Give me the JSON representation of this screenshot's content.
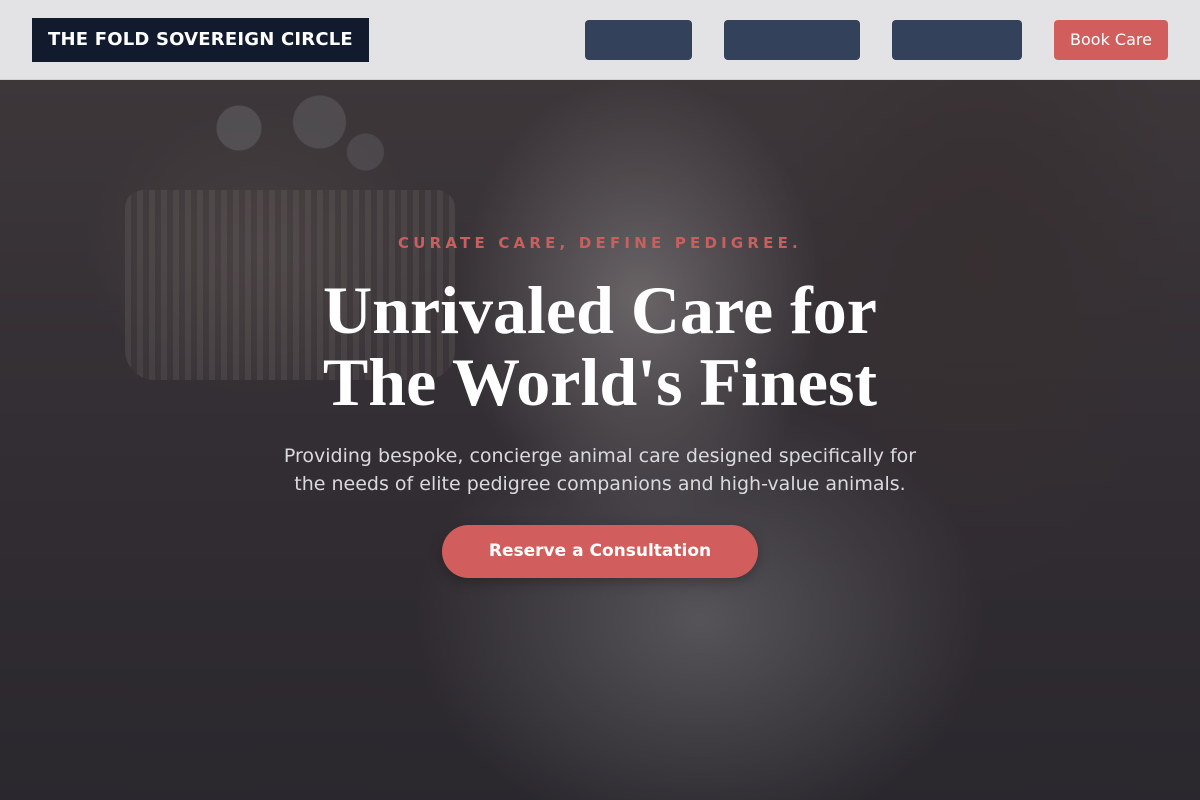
{
  "header": {
    "brand": "THE FOLD SOVEREIGN CIRCLE",
    "nav_items": [
      "",
      "",
      ""
    ],
    "book_label": "Book Care"
  },
  "hero": {
    "eyebrow": "CURATE CARE, DEFINE PEDIGREE.",
    "headline_line1": "Unrivaled Care for",
    "headline_line2": "The World's Finest",
    "subtext_line1": "Providing bespoke, concierge animal care designed specifically for",
    "subtext_line2": "the needs of elite pedigree companions and high-value animals.",
    "cta_label": "Reserve a Consultation"
  },
  "colors": {
    "brand_bg": "#121a2e",
    "nav_button": "#34415a",
    "accent": "#d15e5c",
    "header_bg": "#e8e8ea"
  }
}
